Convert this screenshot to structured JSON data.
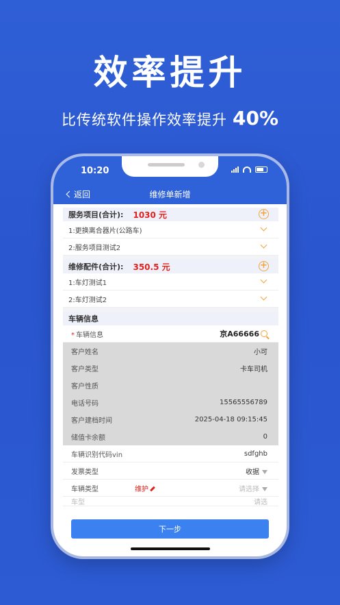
{
  "hero": {
    "title": "效率提升",
    "subtitle": "比传统软件操作效率提升",
    "percent": "40%"
  },
  "status": {
    "time": "10:20"
  },
  "nav": {
    "back": "返回",
    "title": "维修单新增"
  },
  "services": {
    "label": "服务项目(合计):",
    "amount": "1030 元",
    "items": [
      "1:更换离合器片(公路车)",
      "2:服务项目测试2"
    ]
  },
  "parts": {
    "label": "维修配件(合计):",
    "amount": "350.5 元",
    "items": [
      "1:车灯测试1",
      "2:车灯测试2"
    ]
  },
  "vehicle": {
    "section": "车辆信息",
    "vehicle_label": "车辆信息",
    "plate": "京A66666",
    "rows": [
      {
        "label": "客户姓名",
        "value": "小可"
      },
      {
        "label": "客户类型",
        "value": "卡车司机"
      },
      {
        "label": "客户性质",
        "value": ""
      },
      {
        "label": "电话号码",
        "value": "15565556789"
      },
      {
        "label": "客户建档时间",
        "value": "2025-04-18 09:15:45"
      },
      {
        "label": "储值卡余额",
        "value": "0"
      }
    ],
    "vin_label": "车辆识别代码vin",
    "vin": "sdfghb",
    "invoice_label": "发票类型",
    "invoice": "收据",
    "type_label": "车辆类型",
    "type_tag": "维护",
    "type_placeholder": "请选择",
    "partial_label": "车型",
    "partial_value": "请选"
  },
  "next_button": "下一步",
  "colors": {
    "brand": "#2f62d8",
    "accent": "#f2a43a",
    "price": "#e0231f",
    "button": "#3b82f0"
  }
}
